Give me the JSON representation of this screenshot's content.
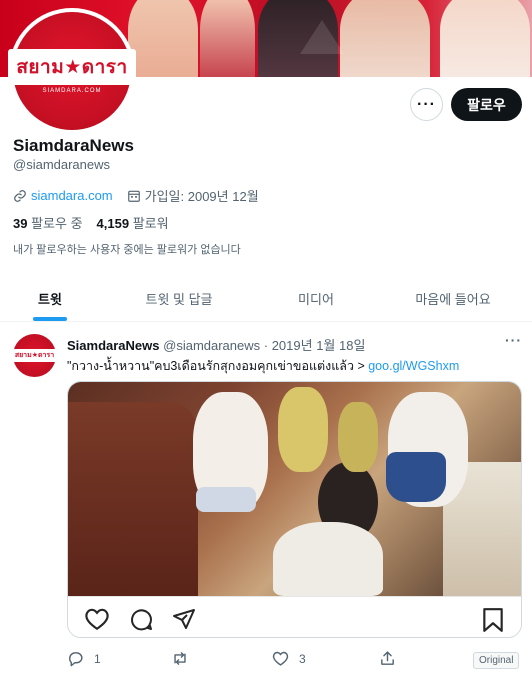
{
  "profile": {
    "logo_text": "สยาม★ดารา",
    "logo_sub": "SIAMDARA.COM",
    "display_name": "SiamdaraNews",
    "handle": "@siamdaranews",
    "website": "siamdara.com",
    "joined": "가입일: 2009년 12월",
    "following_count": "39",
    "following_label": "팔로우 중",
    "followers_count": "4,159",
    "followers_label": "팔로워",
    "no_mutual_note": "내가 팔로우하는 사용자 중에는 팔로워가 없습니다",
    "more_label": "···",
    "follow_label": "팔로우"
  },
  "tabs": [
    {
      "label": "트윗",
      "active": true
    },
    {
      "label": "트윗 및 답글",
      "active": false
    },
    {
      "label": "미디어",
      "active": false
    },
    {
      "label": "마음에 들어요",
      "active": false
    }
  ],
  "tweet": {
    "avatar_text": "สยาม★ดารา",
    "author_name": "SiamdaraNews",
    "author_handle": "@siamdaranews",
    "separator": " · ",
    "date": "2019년 1월 18일",
    "more_label": "···",
    "text": "\"กวาง-น้ำหวาน\"คบ3เดือนรักสุกงอมคุกเข่าขอแต่งแล้ว > ",
    "link": "goo.gl/WGShxm",
    "reply_count": "1",
    "retweet_count": "",
    "like_count": "3",
    "original_label": "Original"
  },
  "colors": {
    "accent": "#1d9bf0",
    "brand_red": "#d2102a",
    "text_primary": "#0f1419",
    "text_secondary": "#536471"
  },
  "icons": [
    "link-icon",
    "calendar-icon",
    "heart-outline-icon",
    "comment-icon",
    "send-icon",
    "bookmark-icon",
    "reply-icon",
    "retweet-icon",
    "like-icon",
    "share-icon"
  ]
}
